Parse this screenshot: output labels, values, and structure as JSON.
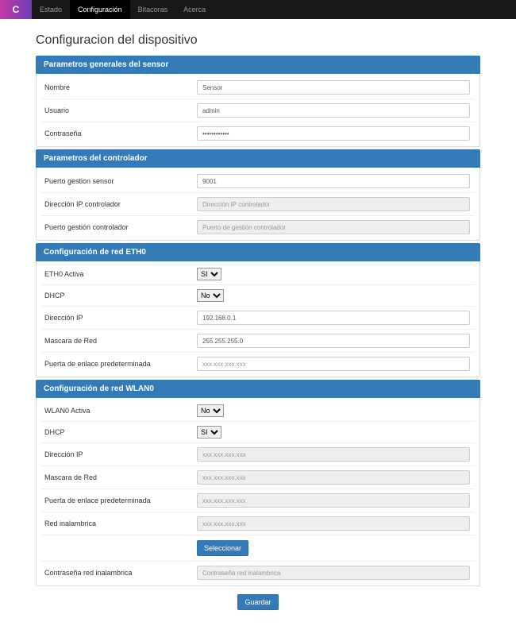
{
  "nav": {
    "brand": "C",
    "items": [
      "Estado",
      "Configuración",
      "Bitacoras",
      "Acerca"
    ],
    "active_index": 1
  },
  "page_title": "Configuracion del dispositivo",
  "sections": {
    "sensor": {
      "heading": "Parametros generales del sensor",
      "nombre_label": "Nombre",
      "nombre_value": "Sensor",
      "usuario_label": "Usuario",
      "usuario_value": "admin",
      "contrasena_label": "Contraseña",
      "contrasena_value": "************"
    },
    "controlador": {
      "heading": "Parametros del controlador",
      "puerto_sensor_label": "Puerto gestion sensor",
      "puerto_sensor_value": "9001",
      "ip_label": "Dirección IP controlador",
      "ip_placeholder": "Dirección IP controlador",
      "puerto_ctrl_label": "Puerto gestión controlador",
      "puerto_ctrl_placeholder": "Puerto de gestión controlador"
    },
    "eth0": {
      "heading": "Configuración de red ETH0",
      "activa_label": "ETH0 Activa",
      "activa_value": "SI",
      "dhcp_label": "DHCP",
      "dhcp_value": "No",
      "ip_label": "Dirección IP",
      "ip_value": "192.168.0.1",
      "mask_label": "Mascara de Red",
      "mask_value": "255.255.255.0",
      "gw_label": "Puerta de enlace predeterminada",
      "gw_placeholder": "xxx.xxx.xxx.xxx"
    },
    "wlan0": {
      "heading": "Configuración de red WLAN0",
      "activa_label": "WLAN0 Activa",
      "activa_value": "No",
      "dhcp_label": "DHCP",
      "dhcp_value": "SI",
      "ip_label": "Dirección IP",
      "ip_placeholder": "xxx.xxx.xxx.xxx",
      "mask_label": "Mascara de Red",
      "mask_placeholder": "xxx.xxx.xxx.xxx",
      "gw_label": "Puerta de enlace predeterminada",
      "gw_placeholder": "xxx.xxx.xxx.xxx",
      "ssid_label": "Red inalambrica",
      "ssid_placeholder": "xxx.xxx.xxx.xxx",
      "select_btn": "Seleccionar",
      "pwd_label": "Contraseña red inalambrica",
      "pwd_placeholder": "Contraseña red inalambrica"
    }
  },
  "select_options": {
    "si": "SI",
    "no": "No"
  },
  "submit_label": "Guardar"
}
